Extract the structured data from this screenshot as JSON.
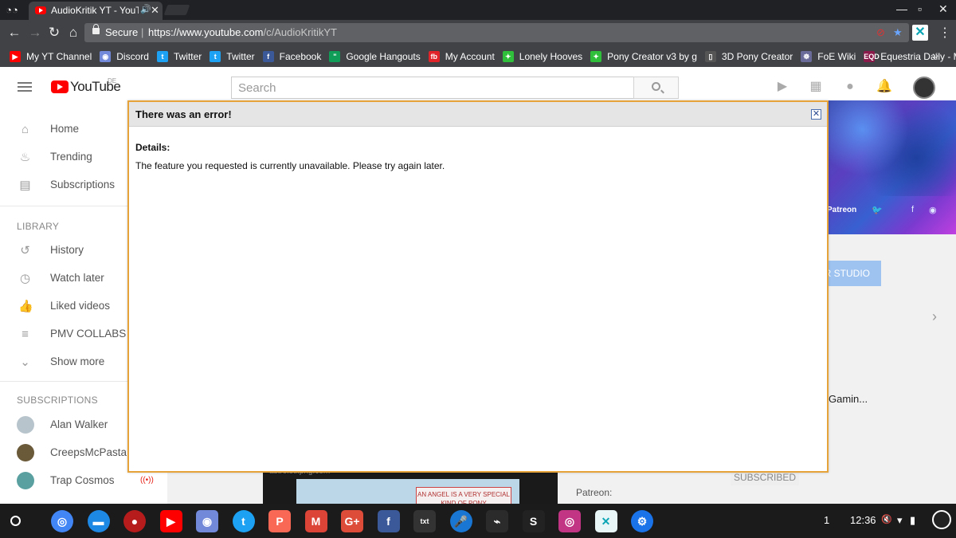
{
  "browser": {
    "tab_title": "AudioKritik YT - YouT",
    "audio_indicator": "🔊",
    "url_secure_label": "Secure",
    "url_base": "https://www.youtube.com",
    "url_path": "/c/AudioKritikYT",
    "bookmarks": [
      {
        "label": "My YT Channel",
        "icon": "youtube-icon",
        "color": "#ff0000",
        "glyph": "▶"
      },
      {
        "label": "Discord",
        "icon": "discord-icon",
        "color": "#7289da",
        "glyph": "◉"
      },
      {
        "label": "Twitter",
        "icon": "twitter-icon",
        "color": "#1da1f2",
        "glyph": "t"
      },
      {
        "label": "Twitter",
        "icon": "twitter-icon",
        "color": "#1da1f2",
        "glyph": "t"
      },
      {
        "label": "Facebook",
        "icon": "facebook-icon",
        "color": "#3b5998",
        "glyph": "f"
      },
      {
        "label": "Google Hangouts",
        "icon": "hangouts-icon",
        "color": "#0f9d58",
        "glyph": "\""
      },
      {
        "label": "My Account",
        "icon": "account-icon",
        "color": "#e0242a",
        "glyph": "fb"
      },
      {
        "label": "Lonely Hooves",
        "icon": "pony-icon",
        "color": "#2fbf3a",
        "glyph": "✦"
      },
      {
        "label": "Pony Creator v3 by g",
        "icon": "pony-icon",
        "color": "#2fbf3a",
        "glyph": "✦"
      },
      {
        "label": "3D Pony Creator",
        "icon": "page-icon",
        "color": "#555555",
        "glyph": "▯"
      },
      {
        "label": "FoE Wiki",
        "icon": "wiki-icon",
        "color": "#6b6b9a",
        "glyph": "☸"
      },
      {
        "label": "Equestria Daily - MLP",
        "icon": "eqd-icon",
        "color": "#8a1a4a",
        "glyph": "EQD"
      }
    ],
    "bookmarks_more": "»"
  },
  "youtube": {
    "logo_text": "YouTube",
    "logo_region": "DE",
    "search_placeholder": "Search",
    "guide": {
      "main": [
        {
          "label": "Home",
          "icon": "home-icon",
          "glyph": "⌂"
        },
        {
          "label": "Trending",
          "icon": "flame-icon",
          "glyph": "♨"
        },
        {
          "label": "Subscriptions",
          "icon": "subscriptions-icon",
          "glyph": "▤"
        }
      ],
      "library_heading": "LIBRARY",
      "library": [
        {
          "label": "History",
          "icon": "history-icon",
          "glyph": "↺"
        },
        {
          "label": "Watch later",
          "icon": "clock-icon",
          "glyph": "◷"
        },
        {
          "label": "Liked videos",
          "icon": "thumbs-up-icon",
          "glyph": "👍"
        },
        {
          "label": "PMV COLLABS",
          "icon": "playlist-icon",
          "glyph": "≡"
        },
        {
          "label": "Show more",
          "icon": "chevron-down-icon",
          "glyph": "⌄"
        }
      ],
      "subscriptions_heading": "SUBSCRIPTIONS",
      "subscriptions": [
        {
          "label": "Alan Walker",
          "color": "#b8c4cc"
        },
        {
          "label": "CreepsMcPasta",
          "color": "#6a5a3a"
        },
        {
          "label": "Trap Cosmos",
          "color": "#5aa0a0",
          "live": "((•))"
        }
      ]
    },
    "banner_patreon": "Patreon",
    "studio_button": "R STUDIO",
    "gaming_text": "Gamin...",
    "video_site": "astrolotl.png.com",
    "comic_text": "AN ANGEL IS A VERY SPECIAL KIND OF PONY",
    "subscribed_label": "SUBSCRIBED",
    "patreon_label": "Patreon:"
  },
  "dialog": {
    "title": "There was an error!",
    "close_glyph": "✕",
    "details_label": "Details:",
    "message": "The feature you requested is currently unavailable. Please try again later."
  },
  "shelf": {
    "apps": [
      {
        "name": "chrome-icon",
        "color": "#4285f4",
        "glyph": "◎",
        "round": true
      },
      {
        "name": "files-icon",
        "color": "#1e88e5",
        "glyph": "▬",
        "round": true
      },
      {
        "name": "apple-icon",
        "color": "#b71c1c",
        "glyph": "●",
        "round": true
      },
      {
        "name": "youtube-icon",
        "color": "#ff0000",
        "glyph": "▶",
        "round": false
      },
      {
        "name": "discord-icon",
        "color": "#7289da",
        "glyph": "◉",
        "round": false
      },
      {
        "name": "twitter-icon",
        "color": "#1da1f2",
        "glyph": "t",
        "round": true
      },
      {
        "name": "patreon-icon",
        "color": "#f96854",
        "glyph": "P",
        "round": false
      },
      {
        "name": "gmail-icon",
        "color": "#db4437",
        "glyph": "M",
        "round": false
      },
      {
        "name": "google-plus-icon",
        "color": "#dd4b39",
        "glyph": "G+",
        "round": false
      },
      {
        "name": "facebook-icon",
        "color": "#3b5998",
        "glyph": "f",
        "round": false
      },
      {
        "name": "text-editor-icon",
        "color": "#333333",
        "glyph": "txt",
        "round": false
      },
      {
        "name": "microphone-icon",
        "color": "#1976d2",
        "glyph": "🎤",
        "round": true
      },
      {
        "name": "terminal-icon",
        "color": "#2b2b2b",
        "glyph": "⌁",
        "round": false
      },
      {
        "name": "app-s-icon",
        "color": "#222222",
        "glyph": "S",
        "round": false
      },
      {
        "name": "instagram-icon",
        "color": "#c13584",
        "glyph": "◎",
        "round": false
      },
      {
        "name": "x-app-icon",
        "color": "#e8f6f7",
        "glyph": "✕",
        "round": false
      },
      {
        "name": "settings-icon",
        "color": "#1a73e8",
        "glyph": "⚙",
        "round": true
      }
    ],
    "notification_count": "1",
    "time": "12:36",
    "muted_glyph": "🔇",
    "wifi_glyph": "▾",
    "battery_glyph": "▮"
  }
}
